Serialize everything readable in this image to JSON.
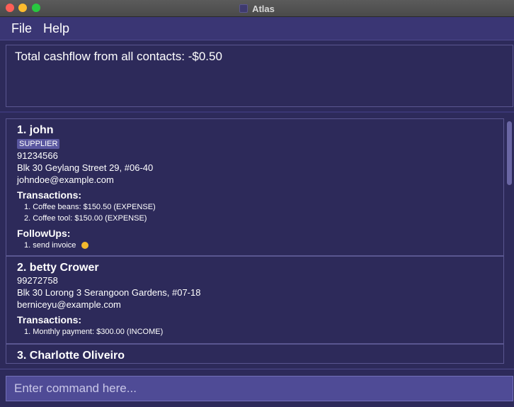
{
  "window": {
    "title": "Atlas"
  },
  "menu": {
    "items": [
      "File",
      "Help"
    ]
  },
  "result": {
    "text": "Total cashflow from all contacts: -$0.50"
  },
  "contacts": [
    {
      "name": "1. john",
      "tags": [
        "SUPPLIER"
      ],
      "phone": "91234566",
      "address": "Blk 30 Geylang Street 29, #06-40",
      "email": "johndoe@example.com",
      "transactions_label": "Transactions:",
      "transactions": [
        "1. Coffee beans: $150.50 (EXPENSE)",
        "2. Coffee tool: $150.00 (EXPENSE)"
      ],
      "followups_label": "FollowUps:",
      "followups": [
        "1. send invoice"
      ],
      "followup_status_color": "#f3b92d"
    },
    {
      "name": "2. betty Crower",
      "phone": "99272758",
      "address": "Blk 30 Lorong 3 Serangoon Gardens, #07-18",
      "email": "berniceyu@example.com",
      "transactions_label": "Transactions:",
      "transactions": [
        "1. Monthly payment: $300.00 (INCOME)"
      ]
    },
    {
      "name": "3. Charlotte Oliveiro"
    }
  ],
  "command": {
    "placeholder": "Enter command here...",
    "value": ""
  },
  "colors": {
    "background": "#2d2a5a",
    "menubar": "#3a3674",
    "tag": "#5a57a0",
    "command_box": "#4f4b96",
    "followup_dot": "#f3b92d"
  }
}
